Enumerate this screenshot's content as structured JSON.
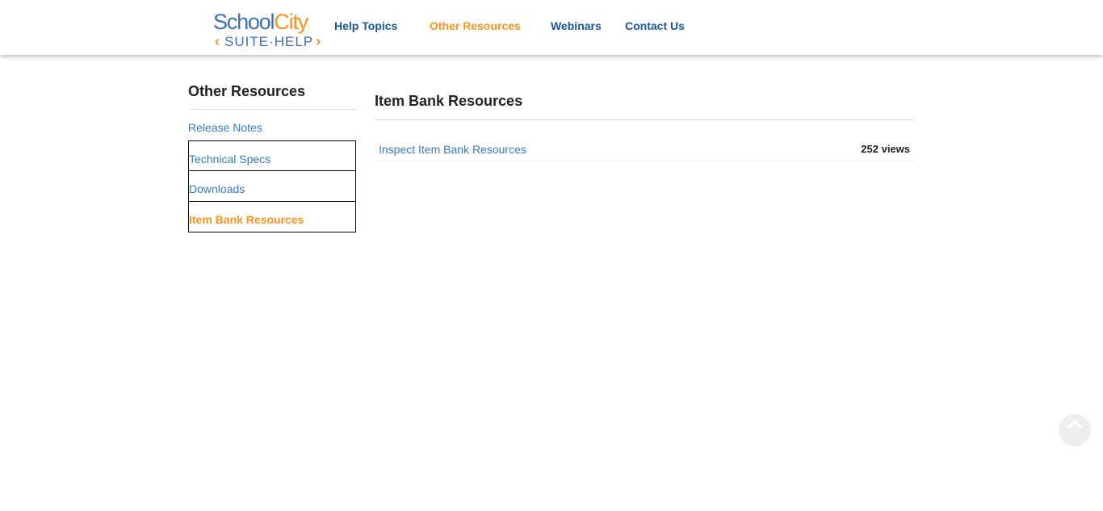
{
  "logo": {
    "school": "School",
    "city": "City",
    "dot": ".",
    "suite_help": "SUITE·HELP",
    "chevron_left": "‹",
    "chevron_right": "›"
  },
  "nav": {
    "items": [
      {
        "label": "Help Topics"
      },
      {
        "label": "Other Resources",
        "active": true
      },
      {
        "label": "Webinars"
      },
      {
        "label": "Contact Us"
      }
    ]
  },
  "sidebar": {
    "title": "Other Resources",
    "items": [
      {
        "label": "Release Notes"
      },
      {
        "label": "Technical Specs"
      },
      {
        "label": "Downloads"
      },
      {
        "label": "Item Bank Resources",
        "active": true
      }
    ]
  },
  "main": {
    "title": "Item Bank Resources",
    "articles": [
      {
        "title": "Inspect Item Bank Resources",
        "views": "252 views"
      }
    ]
  },
  "icons": {
    "scroll_top": "chevron-up-icon"
  },
  "colors": {
    "brand_blue": "#3f6fb4",
    "nav_blue": "#1a5794",
    "link_blue": "#3a78b6",
    "accent_orange": "#f7941e"
  }
}
